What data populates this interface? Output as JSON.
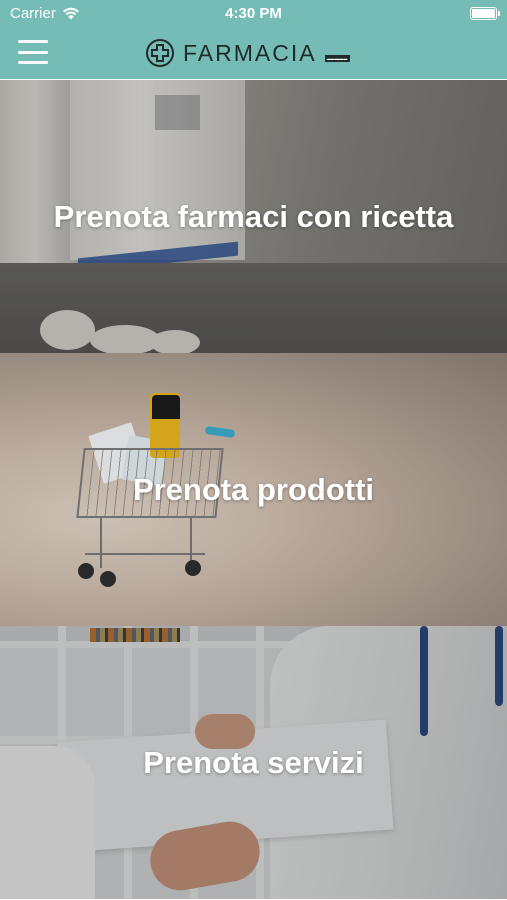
{
  "status_bar": {
    "carrier": "Carrier",
    "time": "4:30 PM",
    "wifi_icon": "wifi-icon",
    "battery_icon": "battery-icon"
  },
  "navbar": {
    "menu_icon": "hamburger-menu-icon",
    "logo_text": "FARMACIA",
    "logo_icon": "pharmacy-cross-icon",
    "header_color": "#74bcb5"
  },
  "tiles": [
    {
      "label": "Prenota farmaci con ricetta"
    },
    {
      "label": "Prenota prodotti"
    },
    {
      "label": "Prenota servizi"
    }
  ]
}
